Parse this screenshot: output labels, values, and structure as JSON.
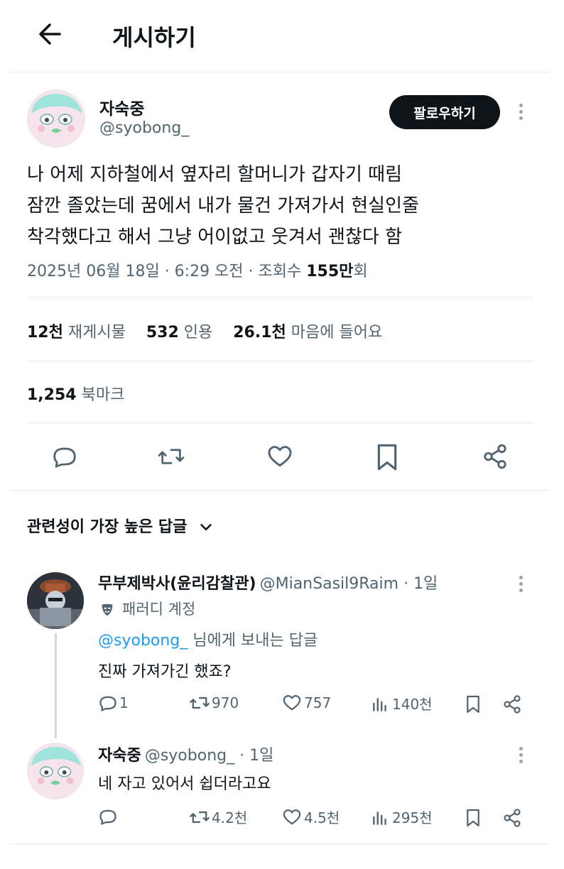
{
  "header": {
    "title": "게시하기"
  },
  "post": {
    "author_name": "자숙중",
    "author_handle": "@syobong_",
    "follow_label": "팔로우하기",
    "text_lines": [
      "나 어제 지하철에서 옆자리 할머니가 갑자기 때림",
      "잠깐 졸았는데 꿈에서 내가 물건 가져가서 현실인줄",
      "착각했다고 해서 그냥 어이없고 웃겨서 괜찮다 함"
    ],
    "meta": {
      "date": "2025년 06월 18일 · 6:29 오전 · 조회수 ",
      "views": "155만",
      "views_suffix": "회"
    },
    "stats": {
      "reposts_num": "12천",
      "reposts_label": "재게시물",
      "quotes_num": "532",
      "quotes_label": "인용",
      "likes_num": "26.1천",
      "likes_label": "마음에 들어요",
      "bookmarks_num": "1,254",
      "bookmarks_label": "북마크"
    }
  },
  "sort": {
    "label": "관련성이 가장 높은 답글"
  },
  "replies": [
    {
      "name": "무부제박사(윤리감찰관)",
      "handle_time": "@MianSasil9Raim · 1일",
      "badge": "패러디 계정",
      "reply_to_handle": "@syobong_",
      "reply_to_suffix": " 님에게 보내는 답글",
      "text": "진짜 가져가긴 했죠?",
      "actions": {
        "replies": "1",
        "reposts": "970",
        "likes": "757",
        "views": "140천"
      }
    },
    {
      "name": "자숙중",
      "handle_time": "@syobong_ · 1일",
      "text": "네 자고 있어서 쉽더라고요",
      "actions": {
        "replies": "",
        "reposts": "4.2천",
        "likes": "4.5천",
        "views": "295천"
      }
    }
  ],
  "icons": [
    "back-arrow-icon",
    "more-icon",
    "reply-icon",
    "repost-icon",
    "like-icon",
    "bookmark-icon",
    "share-icon",
    "chevron-down-icon",
    "parody-mask-icon",
    "views-icon"
  ]
}
